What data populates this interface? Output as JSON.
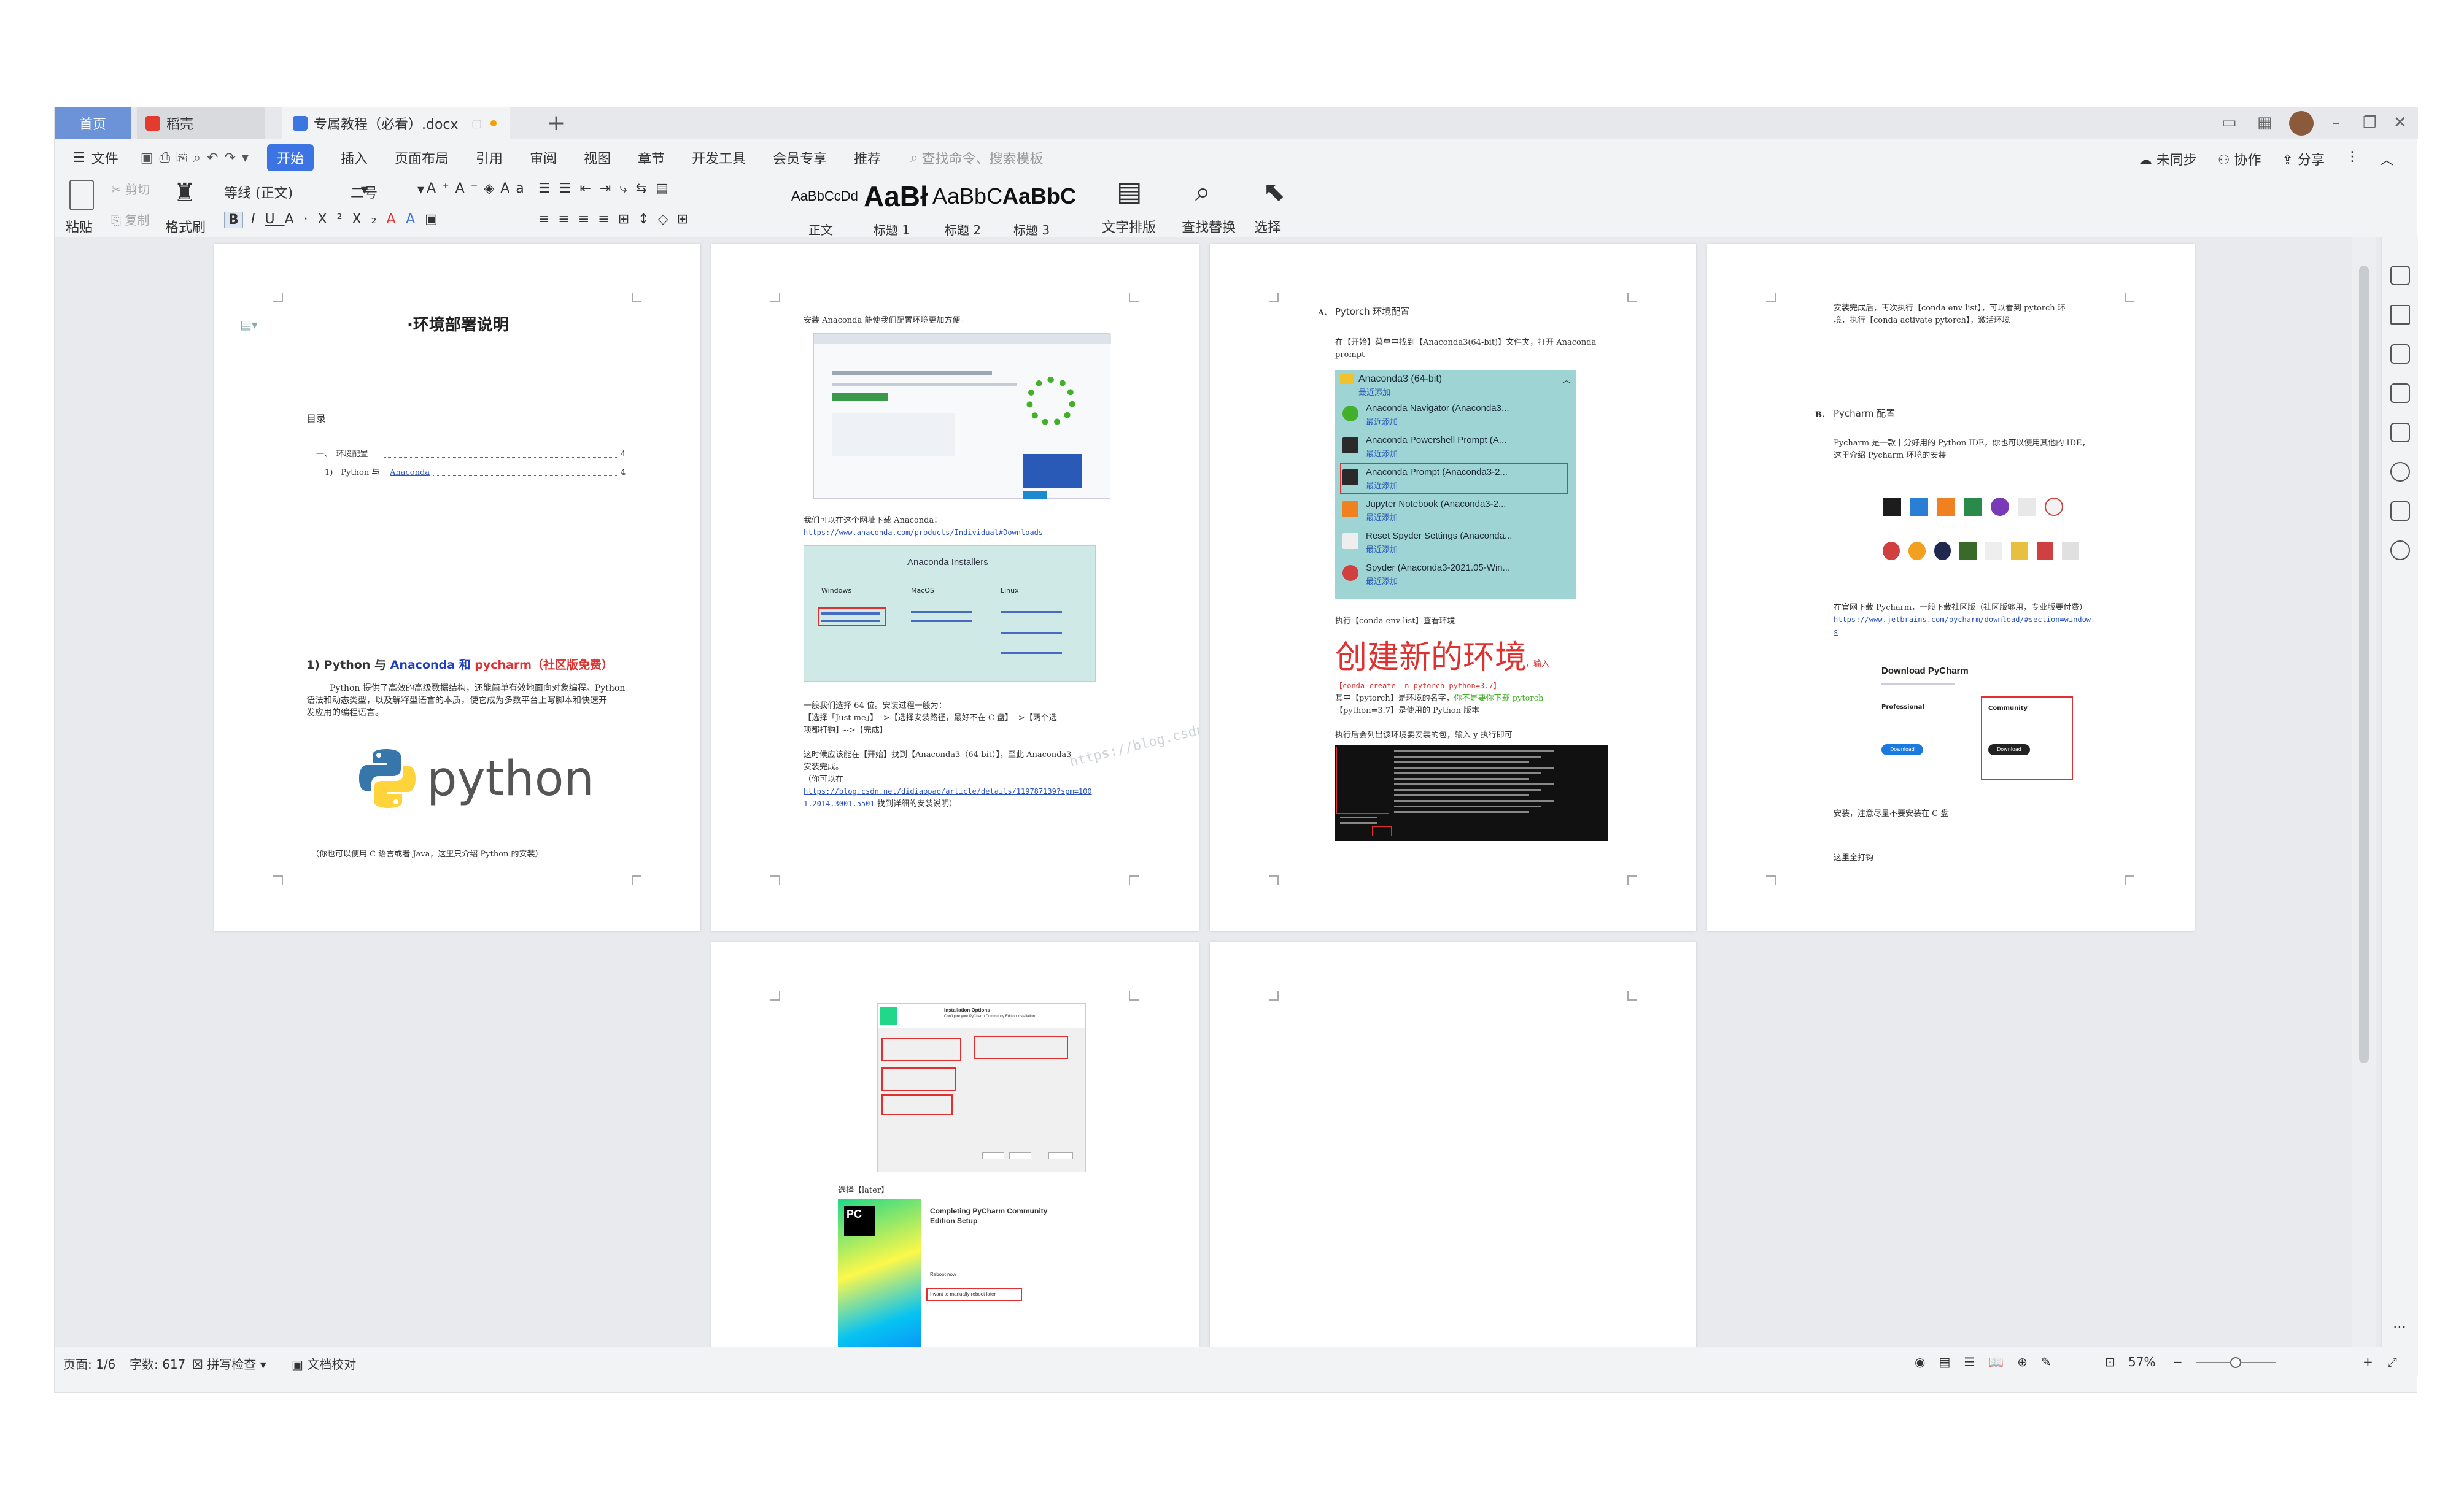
{
  "tabs": {
    "home": "首页",
    "doc1": "稻壳",
    "doc2": "专属教程（必看）.docx"
  },
  "menu": {
    "file": "文件",
    "items": [
      "开始",
      "插入",
      "页面布局",
      "引用",
      "审阅",
      "视图",
      "章节",
      "开发工具",
      "会员专享",
      "推荐"
    ],
    "search_placeholder": "查找命令、搜索模板",
    "right": [
      "未同步",
      "协作",
      "分享"
    ]
  },
  "ribbon": {
    "paste": "粘贴",
    "cut": "剪切",
    "copy": "复制",
    "format_painter": "格式刷",
    "font": "等线 (正文)",
    "size": "二号",
    "styles": [
      {
        "sample": "AaBbCcDd",
        "label": "正文"
      },
      {
        "sample": "AaBł",
        "label": "标题 1"
      },
      {
        "sample": "AaBbC",
        "label": "标题 2"
      },
      {
        "sample": "AaBbC",
        "label": "标题 3"
      }
    ],
    "text_layout": "文字排版",
    "find_replace": "查找替换",
    "select": "选择"
  },
  "colors": {
    "accent": "#3d74e4",
    "home_tab": "#6c93d8",
    "red": "#e03030",
    "link": "#2a52be",
    "anaconda_green": "#43b02a"
  },
  "page1": {
    "title": "·环境部署说明",
    "toc": "目录",
    "toc1": "一、　环境配置",
    "toc1_page": "4",
    "toc2": "1)　Python 与",
    "toc2_link": "Anaconda",
    "toc2_page": "4",
    "heading_prefix": "1) Python 与",
    "heading_anaconda": "Anaconda",
    "heading_and": "和",
    "heading_pycharm": "pycharm（社区版免费）",
    "para1": "Python 提供了高效的高级数据结构，还能简单有效地面向对象编程。Python",
    "para2": "语法和动态类型，以及解释型语言的本质，使它成为多数平台上写脚本和快速开",
    "para3": "发应用的编程语言。",
    "logo_text": "python",
    "note": "（你也可以使用 C 语言或者 Java，这里只介绍 Python 的安装）"
  },
  "page2": {
    "intro": "安装 Anaconda 能使我们配置环境更加方便。",
    "download_text": "我们可以在这个网址下载 Anaconda：",
    "download_url": "https://www.anaconda.com/products/Individual#Downloads",
    "installers_title": "Anaconda Installers",
    "os": [
      "Windows",
      "MacOS",
      "Linux"
    ],
    "choose1": "一般我们选择 64 位。安装过程一般为：",
    "choose2": "【选择「Just me」】-->【选择安装路径，最好不在 C 盘】-->【两个选",
    "choose3": "项都打钩】-->【完成】",
    "after1": "这时候应该能在【开始】找到【Anaconda3（64-bit）】，至此 Anaconda3",
    "after2": "安装完成。",
    "after3": "（你可以在",
    "blog_url1": "https://blog.csdn.net/didiaopao/article/details/119787139?spm=100",
    "blog_url2": "1.2014.3001.5501",
    "blog_tail": "找到详细的安装说明）"
  },
  "page3": {
    "section": "A.",
    "section_title": "Pytorch 环境配置",
    "step1": "在【开始】菜单中找到【Anaconda3(64-bit)】文件夹，打开 Anaconda",
    "step1b": "prompt",
    "menu_header": "Anaconda3 (64-bit)",
    "recent": "最近添加",
    "menu_items": [
      "Anaconda Navigator (Anaconda3...",
      "Anaconda Powershell Prompt (A...",
      "Anaconda Prompt (Anaconda3-2...",
      "Jupyter Notebook (Anaconda3-2...",
      "Reset Spyder Settings (Anaconda...",
      "Spyder (Anaconda3-2021.05-Win..."
    ],
    "step2": "执行【conda env list】查看环境",
    "create_env": "创建新的环境",
    "input_word": "，输入",
    "cmd": "【conda create -n pytorch python=3.7】",
    "explain1": "其中【pytorch】是环境的名字，",
    "explain_green": "你不是要你下载 pytorch。",
    "explain2": "【python=3.7】是使用的 Python 版本",
    "step3": "执行后会列出该环境要安装的包，输入 y 执行即可"
  },
  "page4": {
    "line1": "安装完成后，再次执行【conda env list】，可以看到 pytorch 环",
    "line2": "境，执行【conda activate pytorch】，激活环境",
    "section": "B.",
    "section_title": "Pycharm 配置",
    "p1": "Pycharm 是一款十分好用的 Python IDE，你也可以使用其他的 IDE，",
    "p2": "这里介绍 Pycharm 环境的安装",
    "dl1": "在官网下载 Pycharm，一般下载社区版（社区版够用，专业版要付费）",
    "dl_url1": "https://www.jetbrains.com/pycharm/download/#section=window",
    "dl_url2": "s",
    "download_title": "Download PyCharm",
    "pro": "Professional",
    "community": "Community",
    "dl_btn": "Download",
    "note": "安装，注意尽量不要安装在 C 盘",
    "check": "这里全打钩"
  },
  "page5": {
    "install_options": "Installation Options",
    "install_sub": "Configure your PyCharm Community Edition installation",
    "later": "选择【later】",
    "complete_title1": "Completing PyCharm Community",
    "complete_title2": "Edition Setup",
    "reboot_now": "Reboot now",
    "reboot_later": "I want to manually reboot later"
  },
  "watermark": "https://blog.csdn.net",
  "status": {
    "page": "页面: 1/6",
    "words": "字数: 617",
    "spell": "拼写检查",
    "proof": "文档校对",
    "zoom": "57%"
  }
}
